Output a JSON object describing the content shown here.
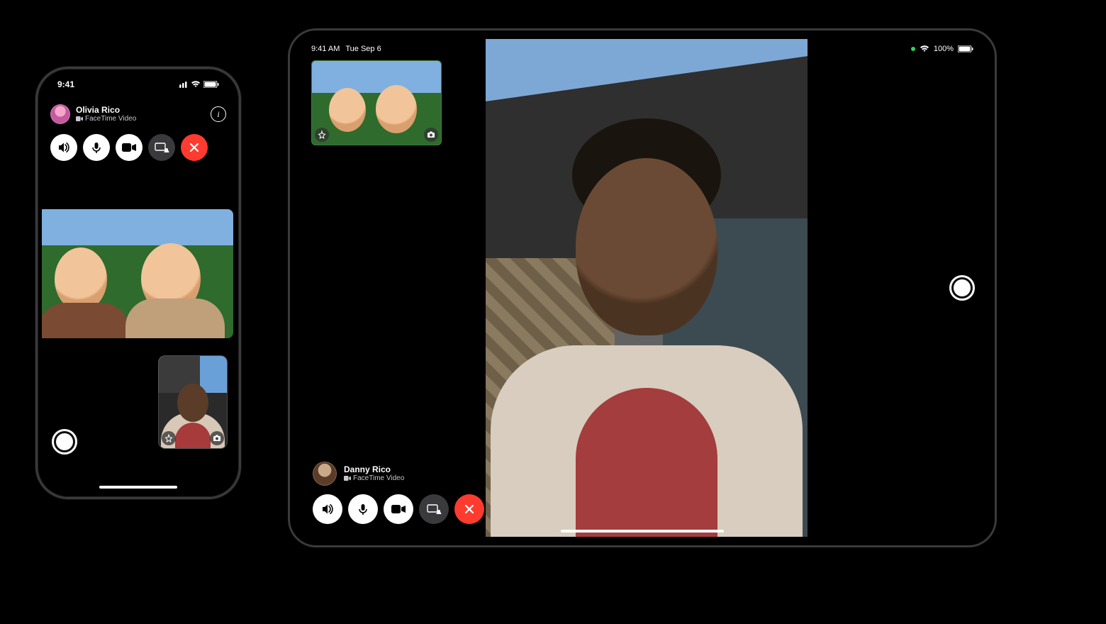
{
  "iphone": {
    "status": {
      "time": "9:41"
    },
    "caller": {
      "name": "Olivia Rico",
      "subtitle": "FaceTime Video"
    },
    "controls": {
      "speaker_icon": "speaker-icon",
      "mic_icon": "mic-icon",
      "video_icon": "video-icon",
      "share_icon": "shareplay-icon",
      "end_icon": "close-icon"
    },
    "pip_icons": {
      "effects": "star-effects-icon",
      "camera": "camera-icon"
    }
  },
  "ipad": {
    "status": {
      "time": "9:41 AM",
      "date": "Tue Sep 6",
      "battery": "100%"
    },
    "caller": {
      "name": "Danny Rico",
      "subtitle": "FaceTime Video"
    },
    "controls": {
      "speaker_icon": "speaker-icon",
      "mic_icon": "mic-icon",
      "video_icon": "video-icon",
      "share_icon": "shareplay-icon",
      "end_icon": "close-icon"
    },
    "pip_icons": {
      "effects": "star-effects-icon",
      "camera": "camera-icon"
    }
  }
}
